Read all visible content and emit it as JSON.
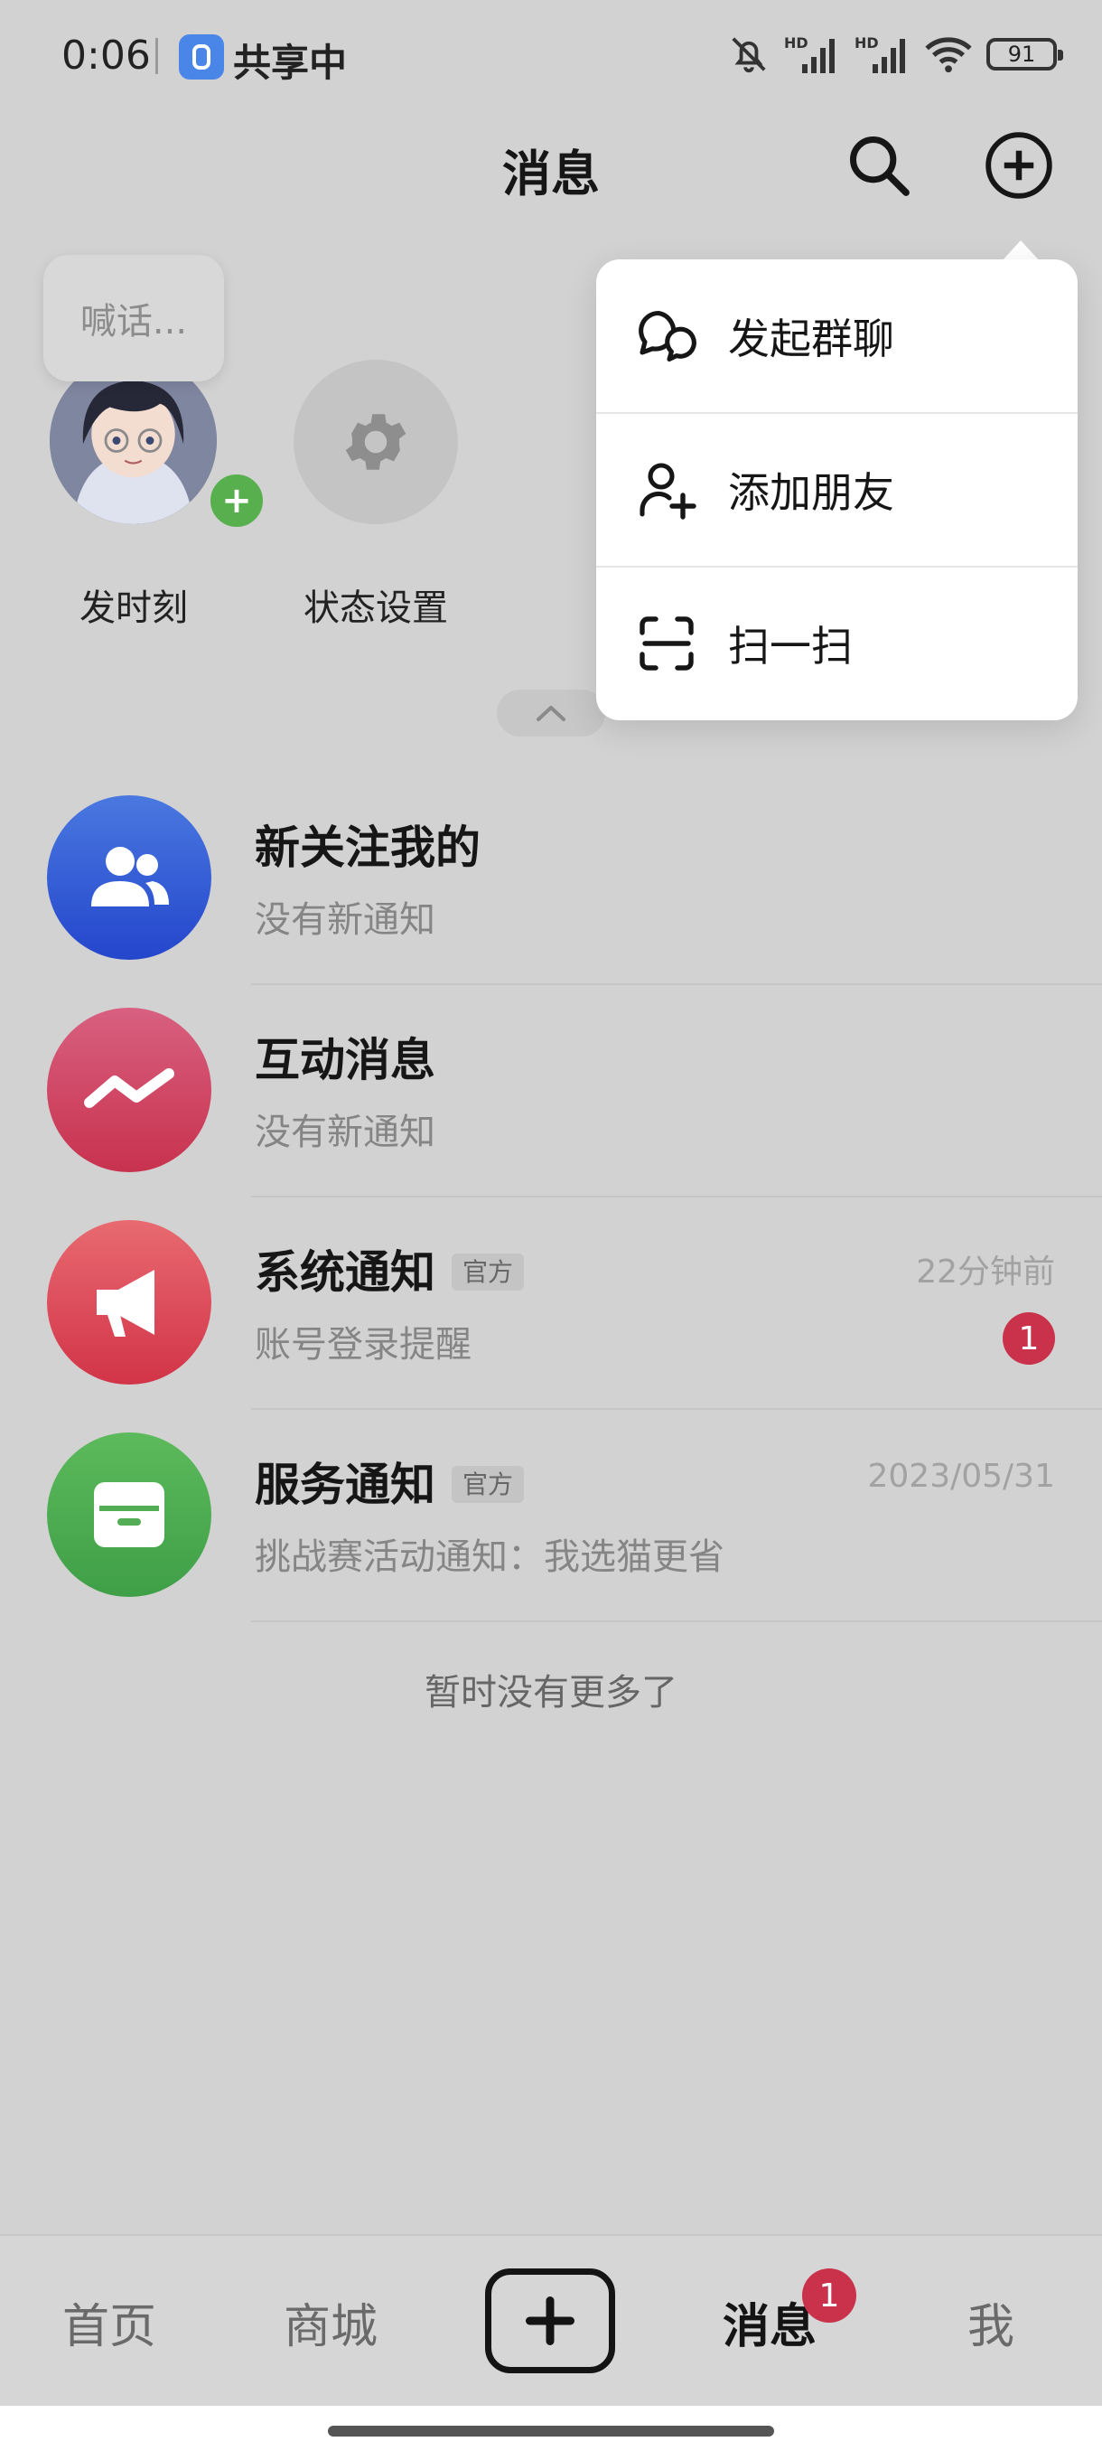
{
  "status_bar": {
    "time": "0:06",
    "share_label": "共享中",
    "battery": "91"
  },
  "header": {
    "title": "消息"
  },
  "story_row": {
    "bubble_text": "喊话...",
    "items": [
      {
        "label": "发时刻"
      },
      {
        "label": "状态设置"
      }
    ]
  },
  "messages": [
    {
      "title": "新关注我的",
      "subtitle": "没有新通知",
      "time": "",
      "tag": "",
      "badge": ""
    },
    {
      "title": "互动消息",
      "subtitle": "没有新通知",
      "time": "",
      "tag": "",
      "badge": ""
    },
    {
      "title": "系统通知",
      "subtitle": "账号登录提醒",
      "time": "22分钟前",
      "tag": "官方",
      "badge": "1"
    },
    {
      "title": "服务通知",
      "subtitle": "挑战赛活动通知：我选猫更省",
      "time": "2023/05/31",
      "tag": "官方",
      "badge": ""
    }
  ],
  "list_footer": "暂时没有更多了",
  "menu": {
    "items": [
      {
        "label": "发起群聊",
        "icon": "group-chat-icon"
      },
      {
        "label": "添加朋友",
        "icon": "add-friend-icon"
      },
      {
        "label": "扫一扫",
        "icon": "scan-icon"
      }
    ]
  },
  "bottom_nav": {
    "items": [
      {
        "label": "首页"
      },
      {
        "label": "商城"
      },
      {
        "label": "消息",
        "badge": "1"
      },
      {
        "label": "我"
      }
    ]
  },
  "colors": {
    "follow": "#3256d8",
    "interact": "#d2486c",
    "system": "#d9485a",
    "service": "#4caf50",
    "badge": "#c9324a"
  }
}
